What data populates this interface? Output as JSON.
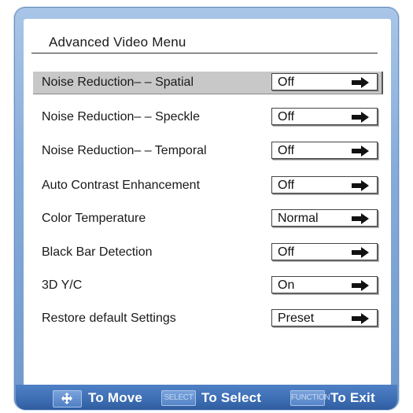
{
  "menu": {
    "title": "Advanced Video Menu",
    "items": [
      {
        "label": "Noise Reduction– – Spatial",
        "value": "Off",
        "selected": true
      },
      {
        "label": "Noise Reduction– – Speckle",
        "value": "Off"
      },
      {
        "label": "Noise Reduction– – Temporal",
        "value": "Off"
      },
      {
        "label": "Auto Contrast Enhancement",
        "value": "Off"
      },
      {
        "label": "Color Temperature",
        "value": "Normal"
      },
      {
        "label": "Black Bar Detection",
        "value": "Off"
      },
      {
        "label": "3D Y/C",
        "value": "On"
      },
      {
        "label": "Restore default Settings",
        "value": "Preset"
      }
    ]
  },
  "footer": {
    "move_icon": "four-way-arrow-icon",
    "move_label": "To Move",
    "select_key": "SELECT",
    "select_label": "To Select",
    "function_key": "FUNCTION",
    "exit_label": "To Exit"
  },
  "colors": {
    "frame_blue": "#86acd9",
    "footer_blue": "#3e6fb5",
    "selected_row": "#c8c8c8"
  }
}
